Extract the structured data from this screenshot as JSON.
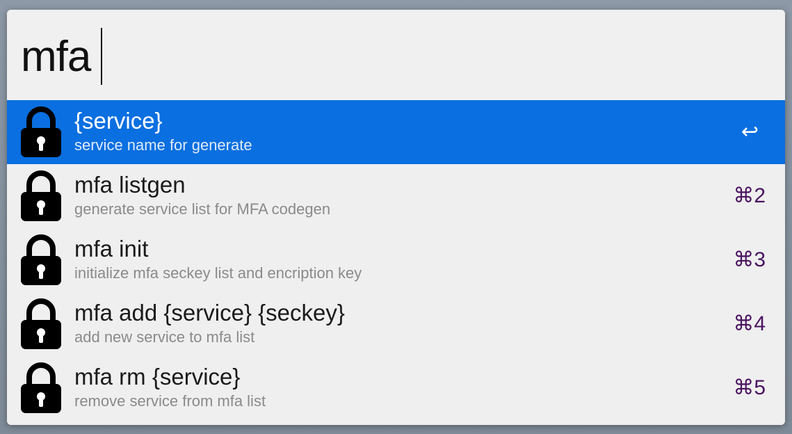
{
  "search": {
    "query": "mfa"
  },
  "results": [
    {
      "title": "{service}",
      "subtitle": "service name for generate",
      "shortcut": "↩",
      "selected": true
    },
    {
      "title": "mfa listgen",
      "subtitle": "generate service list for MFA codegen",
      "shortcut": "⌘2",
      "selected": false
    },
    {
      "title": "mfa init",
      "subtitle": "initialize mfa seckey list and encription key",
      "shortcut": "⌘3",
      "selected": false
    },
    {
      "title": "mfa add {service} {seckey}",
      "subtitle": "add new service to mfa list",
      "shortcut": "⌘4",
      "selected": false
    },
    {
      "title": "mfa rm {service}",
      "subtitle": "remove service from mfa list",
      "shortcut": "⌘5",
      "selected": false
    }
  ],
  "icons": {
    "result_icon": "lock-icon"
  },
  "colors": {
    "selection": "#0a6fe0",
    "shortcut": "#4a1360",
    "subtitle": "#8a8a8a"
  }
}
